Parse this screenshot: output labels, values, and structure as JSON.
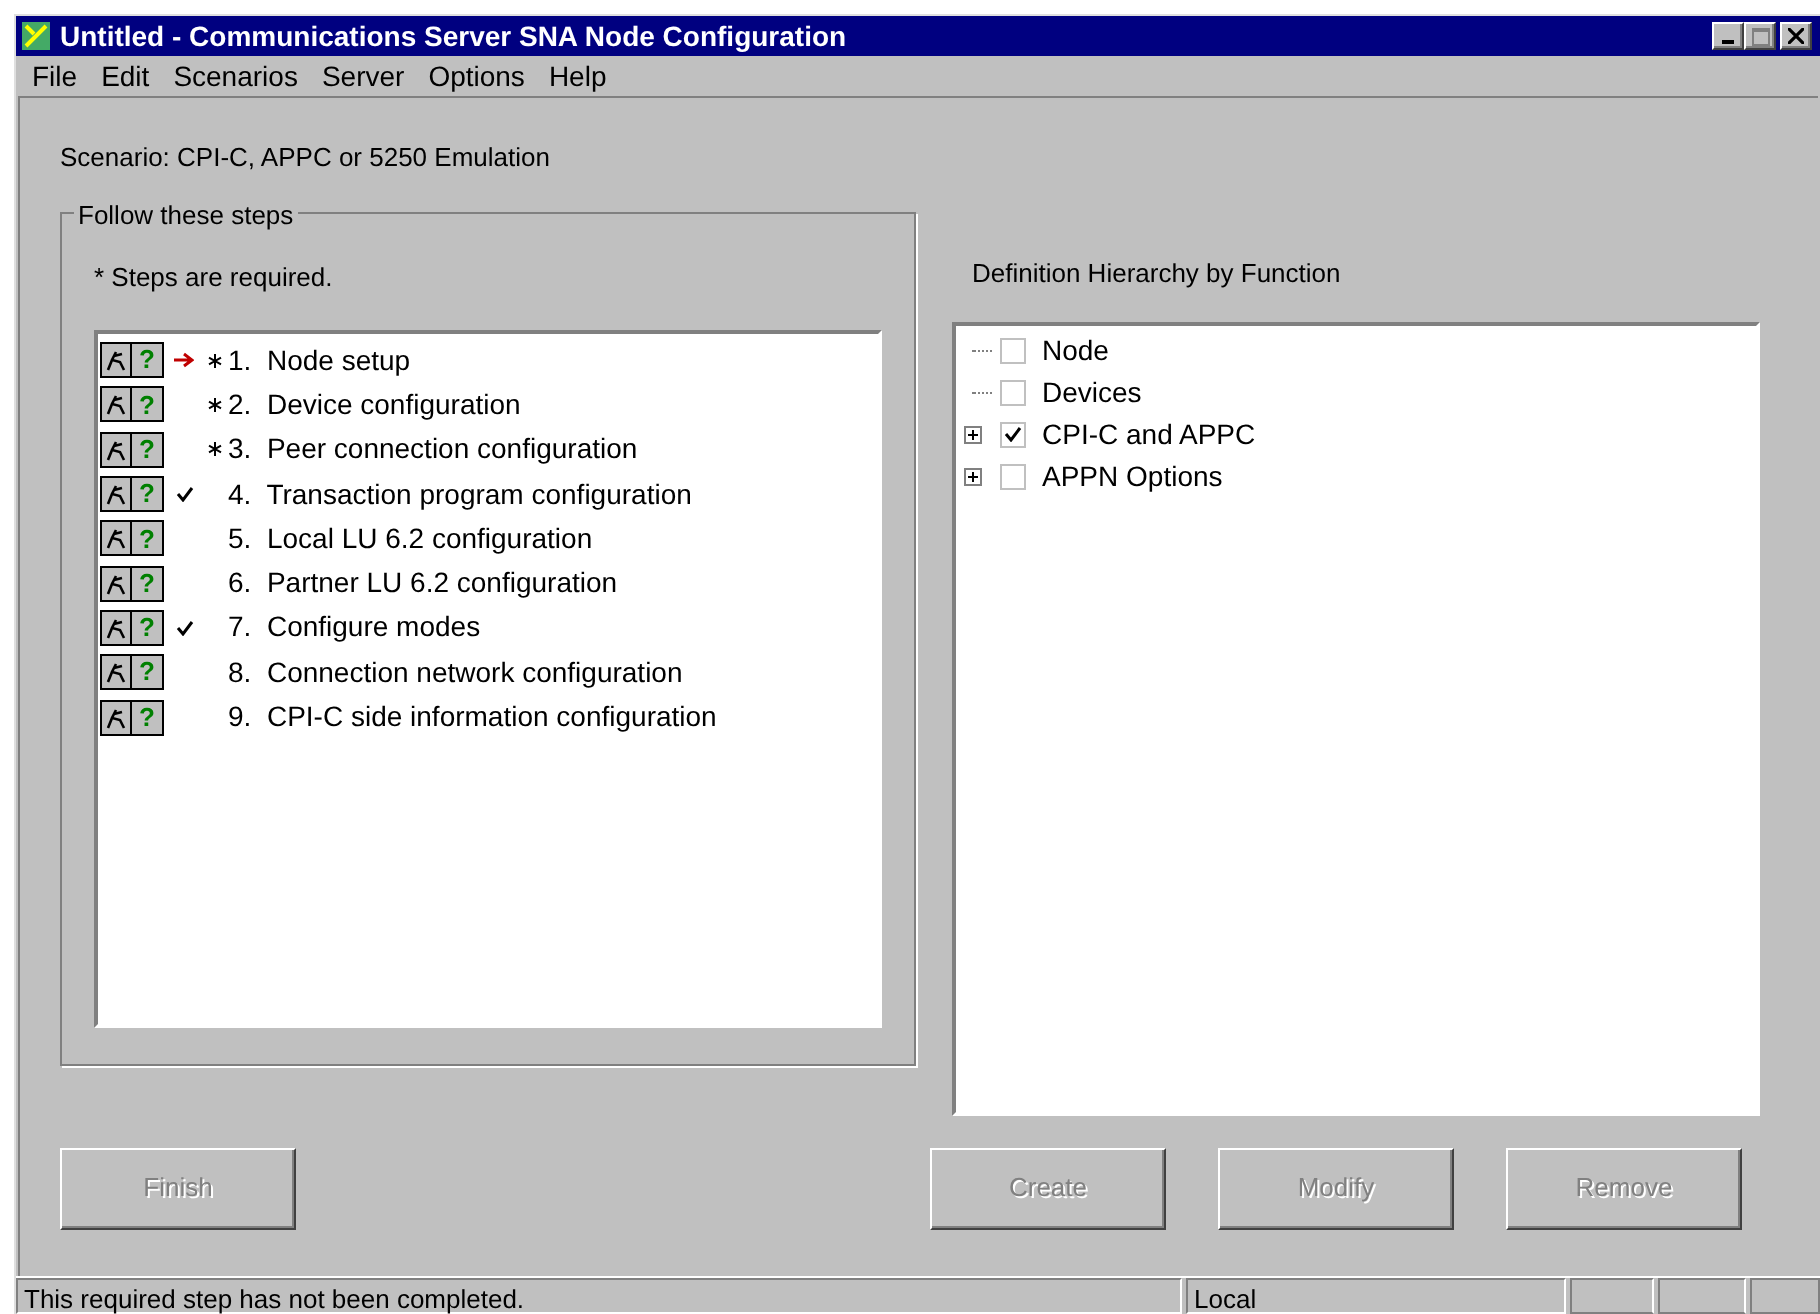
{
  "window": {
    "title": "Untitled - Communications Server SNA Node Configuration"
  },
  "menu": [
    "File",
    "Edit",
    "Scenarios",
    "Server",
    "Options",
    "Help"
  ],
  "scenario": "Scenario: CPI-C, APPC or 5250 Emulation",
  "steps_group": {
    "title": "Follow these steps",
    "note": "* Steps are required.",
    "steps": [
      {
        "help": "?",
        "label": "1.  Node setup",
        "required": true,
        "current": true,
        "done": false
      },
      {
        "help": "?",
        "label": "2.  Device configuration",
        "required": true,
        "current": false,
        "done": false
      },
      {
        "help": "?",
        "label": "3.  Peer connection configuration",
        "required": true,
        "current": false,
        "done": false
      },
      {
        "help": "?",
        "label": "4.  Transaction program configuration",
        "required": false,
        "current": false,
        "done": true
      },
      {
        "help": "?",
        "label": "5.  Local LU 6.2 configuration",
        "required": false,
        "current": false,
        "done": false
      },
      {
        "help": "?",
        "label": "6.  Partner LU 6.2 configuration",
        "required": false,
        "current": false,
        "done": false
      },
      {
        "help": "?",
        "label": "7.  Configure modes",
        "required": false,
        "current": false,
        "done": true
      },
      {
        "help": "?",
        "label": "8.  Connection network configuration",
        "required": false,
        "current": false,
        "done": false
      },
      {
        "help": "?",
        "label": "9.  CPI-C side information configuration",
        "required": false,
        "current": false,
        "done": false
      }
    ]
  },
  "hierarchy": {
    "title": "Definition Hierarchy by Function",
    "items": [
      {
        "label": "Node",
        "checked": false,
        "expandable": false
      },
      {
        "label": "Devices",
        "checked": false,
        "expandable": false
      },
      {
        "label": "CPI-C and APPC",
        "checked": true,
        "expandable": true
      },
      {
        "label": "APPN Options",
        "checked": false,
        "expandable": true
      }
    ]
  },
  "buttons": [
    {
      "label": "Finish",
      "disabled": true
    },
    {
      "label": "Create",
      "disabled": true
    },
    {
      "label": "Modify",
      "disabled": true
    },
    {
      "label": "Remove",
      "disabled": true
    }
  ],
  "status_bar": [
    "This required step has not been completed.",
    "Local"
  ]
}
